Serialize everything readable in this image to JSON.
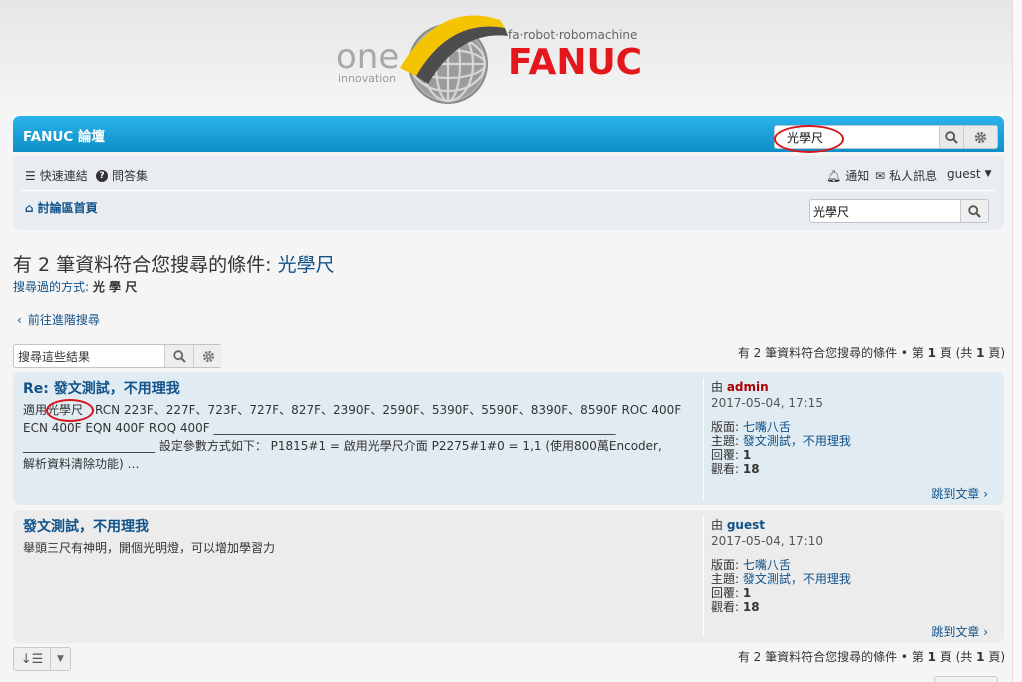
{
  "logo": {
    "one": "one",
    "innovation": "innovation",
    "tagline": "fa·robot·robomachine",
    "brand": "FANUC"
  },
  "header": {
    "site_title": "FANUC 論壇",
    "search_value": "光學尺"
  },
  "navbar": {
    "quick_links": "快速連結",
    "faq": "問答集",
    "notifications": "通知",
    "private_messages": "私人訊息",
    "user": "guest",
    "board_index": "討論區首頁",
    "search_value": "光學尺"
  },
  "results": {
    "heading_prefix": "有 2 筆資料符合您搜尋的條件: ",
    "heading_term": "光學尺",
    "search_method_label": "搜尋過的方式: ",
    "search_method_terms": "光 學 尺",
    "advanced_search": "前往進階搜尋",
    "search_within_placeholder": "搜尋這些結果",
    "pagination": {
      "prefix": "有 2 筆資料符合您搜尋的條件 • 第 ",
      "page": "1",
      "mid": " 頁 (共 ",
      "total": "1",
      "suffix": " 頁)"
    }
  },
  "posts": [
    {
      "title": "Re: 發文測試，不用理我",
      "body_line1_pre": "適用",
      "body_line1_hl": "光學尺",
      "body_line1_post": "　RCN 223F、227F、723F、727F、827F、2390F、2590F、5390F、5590F、8390F、8590F ROC 400F",
      "body_line2": "ECN 400F EQN 400F ROQ 400F ___________________________________________________________________",
      "body_line3": "______________________ 設定參數方式如下： P1815#1 = 啟用光學尺介面 P2275#1#0 = 1,1 (使用800萬Encoder,",
      "body_line4": "解析資料清除功能) …",
      "by": "由 ",
      "author": "admin",
      "date": "2017-05-04, 17:15",
      "forum_label": "版面: ",
      "forum": "七嘴八舌",
      "topic_label": "主題: ",
      "topic": "發文測試，不用理我",
      "replies_label": "回覆: ",
      "replies": "1",
      "views_label": "觀看: ",
      "views": "18",
      "jump": "跳到文章"
    },
    {
      "title": "發文測試，不用理我",
      "body_line1": "舉頭三尺有神明，開個光明燈，可以增加學習力",
      "by": "由 ",
      "author": "guest",
      "date": "2017-05-04, 17:10",
      "forum_label": "版面: ",
      "forum": "七嘴八舌",
      "topic_label": "主題: ",
      "topic": "發文測試，不用理我",
      "replies_label": "回覆: ",
      "replies": "1",
      "views_label": "觀看: ",
      "views": "18",
      "jump": "跳到文章"
    }
  ],
  "colors": {
    "header_blue": "#12a3e2",
    "link": "#105289",
    "admin_red": "#aa0000",
    "fanuc_red": "#e3171c",
    "logo_yellow": "#f5c400",
    "highlight_circle": "#d8141b"
  }
}
